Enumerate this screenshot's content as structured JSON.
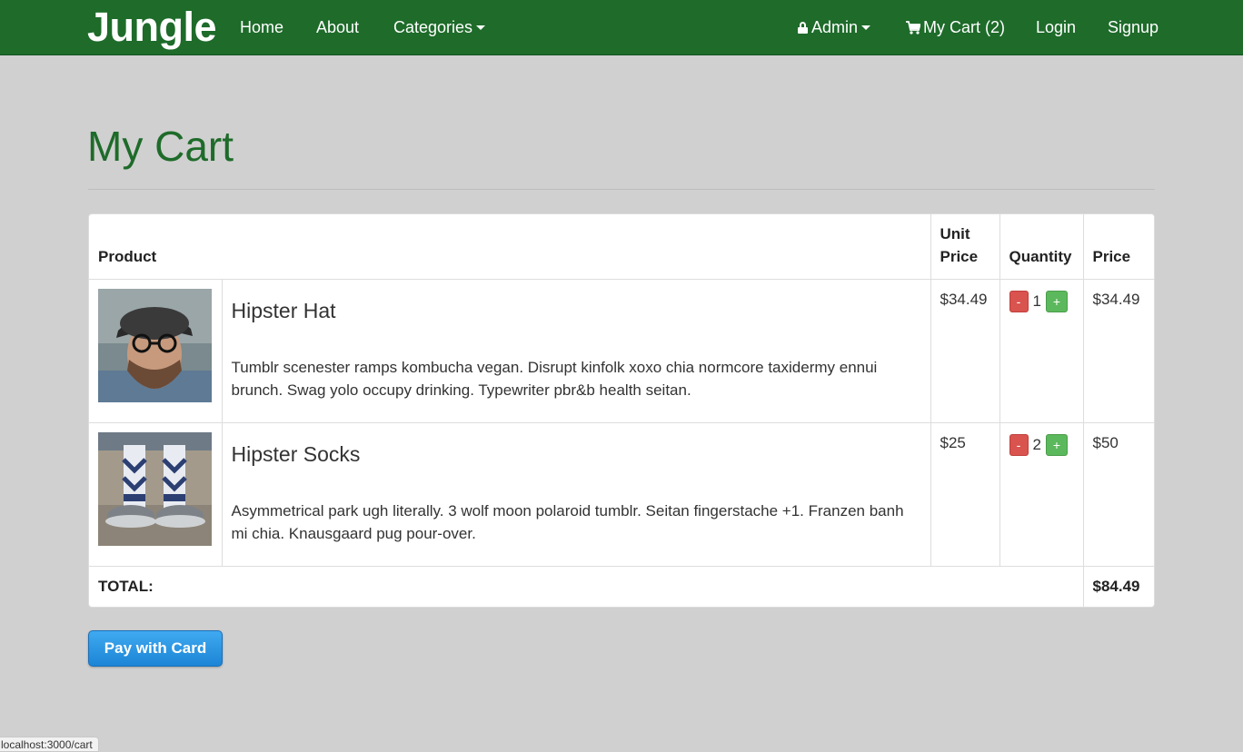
{
  "nav": {
    "brand": "Jungle",
    "home": "Home",
    "about": "About",
    "categories": "Categories",
    "admin": "Admin",
    "cart": "My Cart (2)",
    "login": "Login",
    "signup": "Signup"
  },
  "page": {
    "title": "My Cart"
  },
  "table": {
    "headers": {
      "product": "Product",
      "unit_price": "Unit Price",
      "quantity": "Quantity",
      "price": "Price"
    },
    "items": [
      {
        "name": "Hipster Hat",
        "description": "Tumblr scenester ramps kombucha vegan. Disrupt kinfolk xoxo chia normcore taxidermy ennui brunch. Swag yolo occupy drinking. Typewriter pbr&b health seitan.",
        "unit_price": "$34.49",
        "quantity": "1",
        "price": "$34.49",
        "image_icon": "hipster-hat-photo"
      },
      {
        "name": "Hipster Socks",
        "description": "Asymmetrical park ugh literally. 3 wolf moon polaroid tumblr. Seitan fingerstache +1. Franzen banh mi chia. Knausgaard pug pour-over.",
        "unit_price": "$25",
        "quantity": "2",
        "price": "$50",
        "image_icon": "hipster-socks-photo"
      }
    ],
    "minus_label": "-",
    "plus_label": "+",
    "total_label": "TOTAL:",
    "total_value": "$84.49"
  },
  "pay_button": "Pay with Card",
  "status_url": "localhost:3000/cart",
  "colors": {
    "nav_bg": "#1e6b2a",
    "title_green": "#1e6b2a",
    "minus_red": "#d9534f",
    "plus_green": "#5cb85c",
    "pay_blue": "#1d85d6"
  }
}
